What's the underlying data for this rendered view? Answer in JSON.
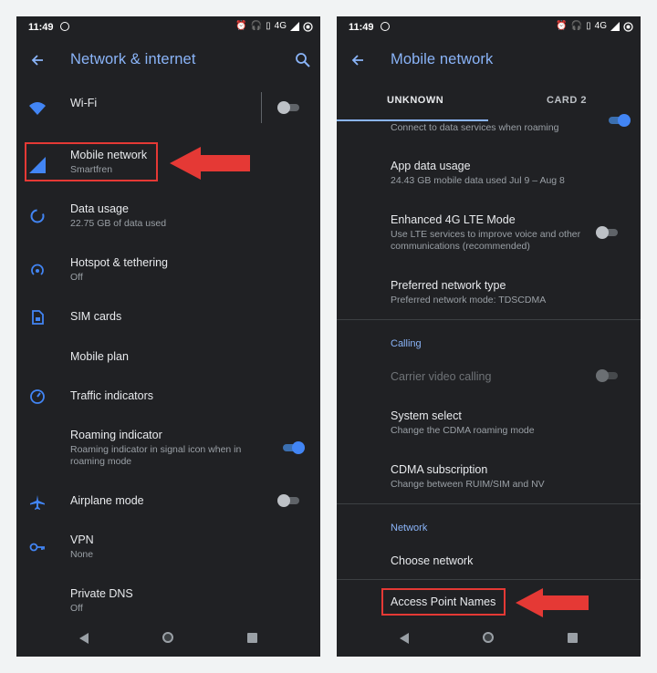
{
  "status": {
    "time": "11:49",
    "network": "4G"
  },
  "left": {
    "title": "Network & internet",
    "items": [
      {
        "title": "Wi-Fi",
        "subtitle": ""
      },
      {
        "title": "Mobile network",
        "subtitle": "Smartfren"
      },
      {
        "title": "Data usage",
        "subtitle": "22.75 GB of data used"
      },
      {
        "title": "Hotspot & tethering",
        "subtitle": "Off"
      },
      {
        "title": "SIM cards",
        "subtitle": ""
      },
      {
        "title": "Mobile plan",
        "subtitle": ""
      },
      {
        "title": "Traffic indicators",
        "subtitle": ""
      },
      {
        "title": "Roaming indicator",
        "subtitle": "Roaming indicator in signal icon when in roaming mode"
      },
      {
        "title": "Airplane mode",
        "subtitle": ""
      },
      {
        "title": "VPN",
        "subtitle": "None"
      },
      {
        "title": "Private DNS",
        "subtitle": "Off"
      }
    ],
    "toggles": {
      "wifi": false,
      "roaming_indicator": true,
      "airplane_mode": false
    }
  },
  "right": {
    "title": "Mobile network",
    "tabs": [
      "UNKNOWN",
      "CARD 2"
    ],
    "roaming_partial": "Connect to data services when roaming",
    "items": [
      {
        "title": "App data usage",
        "subtitle": "24.43 GB mobile data used Jul 9 – Aug 8"
      },
      {
        "title": "Enhanced 4G LTE Mode",
        "subtitle": "Use LTE services to improve voice and other communications (recommended)"
      },
      {
        "title": "Preferred network type",
        "subtitle": "Preferred network mode: TDSCDMA"
      }
    ],
    "calling": {
      "header": "Calling",
      "items": [
        {
          "title": "Carrier video calling",
          "subtitle": ""
        },
        {
          "title": "System select",
          "subtitle": "Change the CDMA roaming mode"
        },
        {
          "title": "CDMA subscription",
          "subtitle": "Change between RUIM/SIM and NV"
        }
      ]
    },
    "network": {
      "header": "Network",
      "items": [
        {
          "title": "Choose network"
        },
        {
          "title": "Access Point Names"
        }
      ]
    },
    "toggles": {
      "data_roaming": true,
      "enhanced_4g_lte": false,
      "carrier_video_calling": false
    }
  },
  "colors": {
    "accent": "#8ab4f8",
    "icon_blue": "#4285f4",
    "annotation_red": "#e53935",
    "background": "#202124"
  }
}
